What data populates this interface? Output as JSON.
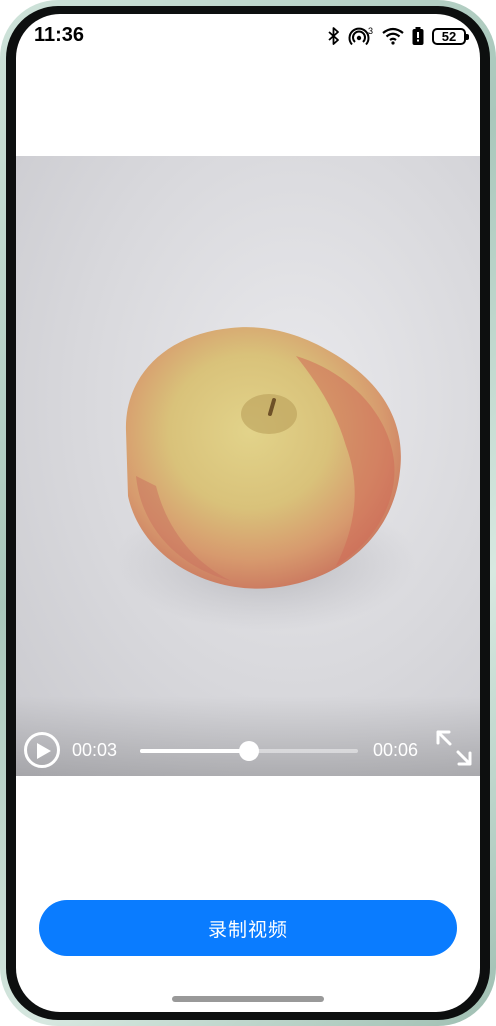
{
  "status_bar": {
    "time": "11:36",
    "battery_level": "52",
    "icons": [
      "bluetooth-icon",
      "hotspot-icon",
      "wifi-icon",
      "battery-alert-icon",
      "battery-icon"
    ],
    "hotspot_badge": "3"
  },
  "video": {
    "current_time": "00:03",
    "total_time": "00:06",
    "progress": 0.5,
    "play_icon": "play-icon",
    "fullscreen_icon": "fullscreen-icon"
  },
  "record_button": {
    "label": "录制视频",
    "color": "#0a7cff"
  }
}
